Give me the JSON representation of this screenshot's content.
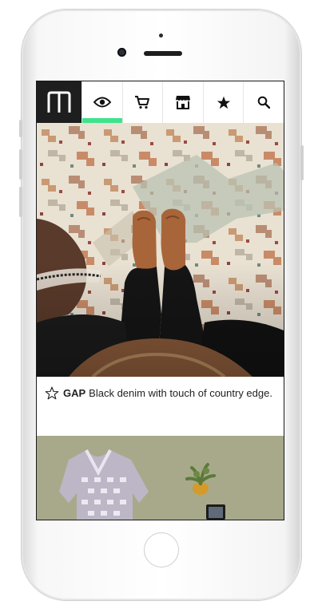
{
  "app": {
    "accent_color": "#3fe38c",
    "nav": {
      "items": [
        {
          "icon": "logo-icon"
        },
        {
          "icon": "eye-icon",
          "active": true
        },
        {
          "icon": "cart-icon"
        },
        {
          "icon": "store-icon"
        },
        {
          "icon": "star-icon"
        },
        {
          "icon": "search-icon"
        }
      ]
    },
    "feed": [
      {
        "image": "boots-on-rug-photo",
        "favorite_icon": "star-outline-icon",
        "brand": "GAP",
        "caption": "Black denim with touch of country edge."
      },
      {
        "image": "sweater-and-plant-photo"
      }
    ]
  }
}
